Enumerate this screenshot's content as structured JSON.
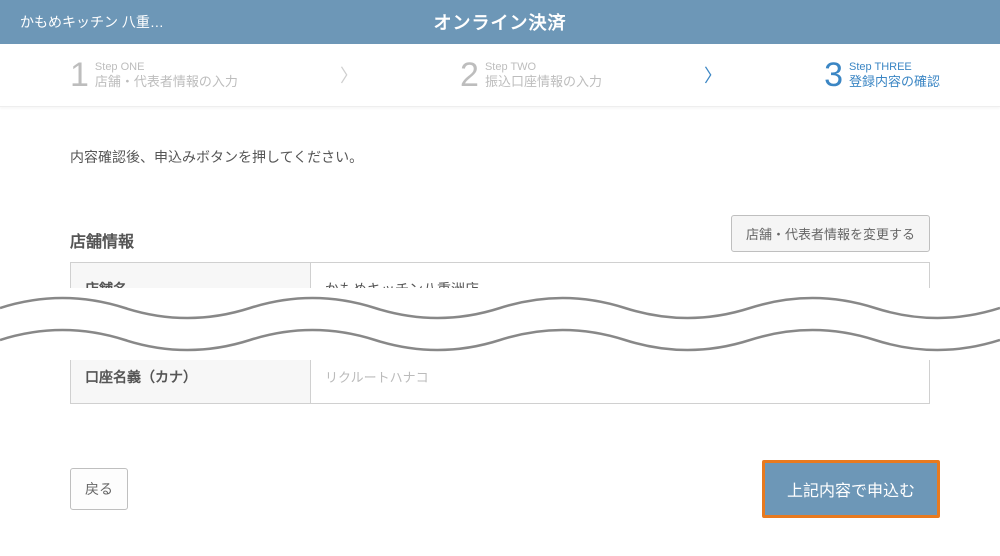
{
  "header": {
    "shop_name": "かもめキッチン 八重…",
    "title": "オンライン決済"
  },
  "steps": {
    "s1": {
      "num": "1",
      "small": "Step ONE",
      "label": "店舗・代表者情報の入力"
    },
    "s2": {
      "num": "2",
      "small": "Step TWO",
      "label": "振込口座情報の入力"
    },
    "s3": {
      "num": "3",
      "small": "Step THREE",
      "label": "登録内容の確認"
    }
  },
  "instruction": "内容確認後、申込みボタンを押してください。",
  "section": {
    "store_title": "店舗情報",
    "edit_button": "店舗・代表者情報を変更する",
    "rows": {
      "shop_name_label": "店舗名",
      "shop_name_value": "かもめキッチン八重洲店",
      "account_kana_label": "口座名義（カナ）",
      "account_kana_value": "リクルートハナコ"
    }
  },
  "buttons": {
    "back": "戻る",
    "submit": "上記内容で申込む"
  }
}
